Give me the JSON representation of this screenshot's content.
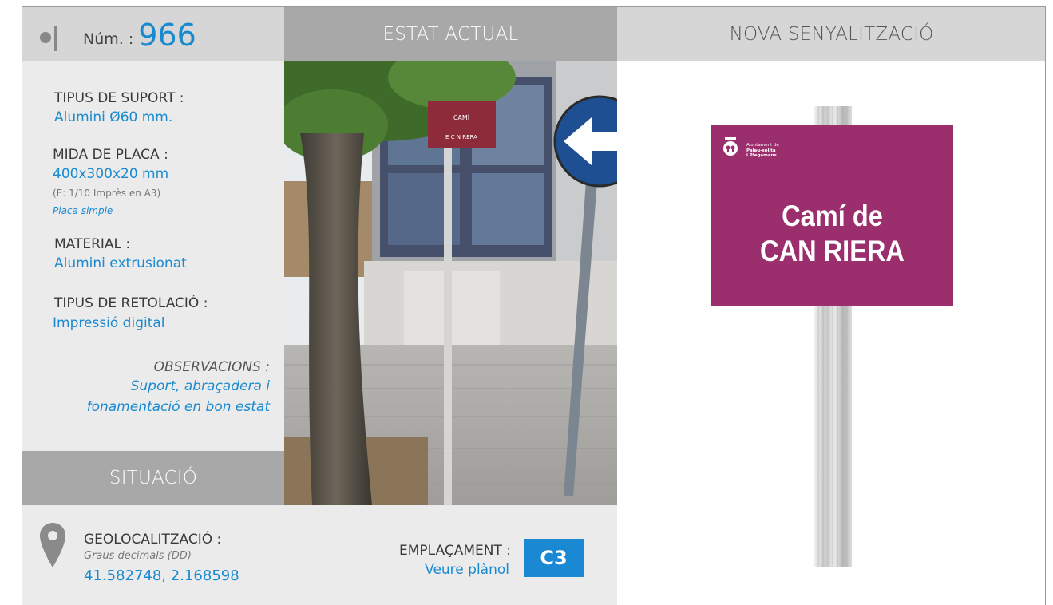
{
  "header": {
    "num_label": "Núm. :",
    "num_value": "966",
    "estat_actual": "ESTAT ACTUAL",
    "nova_senyalitzacio": "NOVA SENYALITZACIÓ"
  },
  "fields": {
    "tipus_suport_label": "TIPUS DE SUPORT :",
    "tipus_suport_value": "Alumini Ø60 mm.",
    "mida_placa_label": "MIDA DE PLACA :",
    "mida_placa_value": "400x300x20 mm",
    "mida_placa_scale": "(E: 1/10 Imprès en A3)",
    "mida_placa_type": "Placa simple",
    "material_label": "MATERIAL :",
    "material_value": "Alumini extrusionat",
    "retolacio_label": "TIPUS DE RETOLACIÓ :",
    "retolacio_value": "Impressió digital",
    "observacions_label": "OBSERVACIONS :",
    "observacions_line1": "Suport, abraçadera i",
    "observacions_line2": "fonamentació en bon estat"
  },
  "situacio": {
    "title": "SITUACIÓ",
    "geo_label": "GEOLOCALITZACIÓ :",
    "geo_format": "Graus decimals (DD)",
    "geo_value": "41.582748, 2.168598",
    "emplacament_label": "EMPLAÇAMENT :",
    "emplacament_link": "Veure plànol",
    "emplacament_code": "C3"
  },
  "photo_sign": {
    "line1": "CAMÍ",
    "line2": "E C N RERA"
  },
  "new_sign": {
    "logo_line1": "Ajuntament de",
    "logo_line2": "Palau-solità",
    "logo_line3": "i Plegamans",
    "title_line1": "Camí de",
    "title_line2": "CAN RIERA"
  },
  "colors": {
    "accent_blue": "#1a8ad0",
    "sign_magenta": "#9b2f6e",
    "header_grey": "#a8a8a8",
    "panel_grey": "#ebebeb"
  }
}
